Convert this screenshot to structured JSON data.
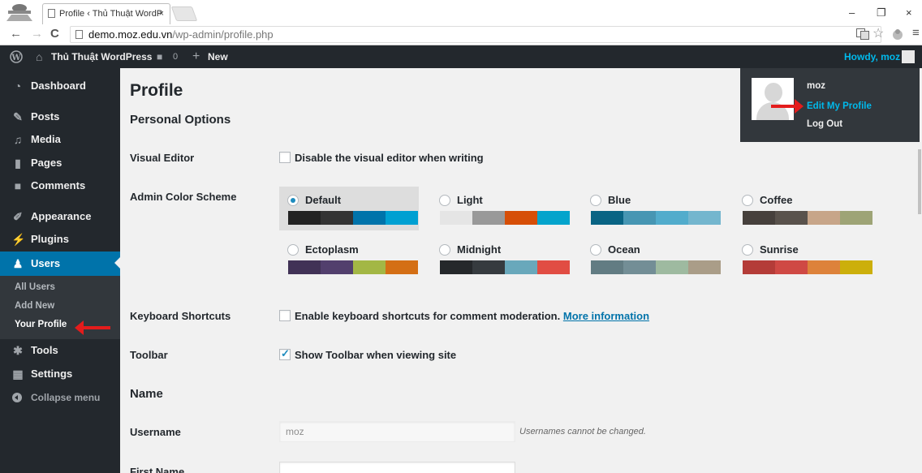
{
  "browser": {
    "tab_title": "Profile ‹ Thủ Thuật WordP",
    "tab_close": "×",
    "url_host": "demo.moz.edu.vn",
    "url_path": "/wp-admin/profile.php",
    "win_min": "–",
    "win_restore": "❐",
    "win_close": "×"
  },
  "adminbar": {
    "site_name": "Thủ Thuật WordPress",
    "comments_count": "0",
    "new_label": "New",
    "howdy": "Howdy, moz"
  },
  "sidebar": {
    "items": [
      {
        "label": "Dashboard",
        "icon": "dashboard-icon"
      },
      {
        "label": "Posts",
        "icon": "pin-icon"
      },
      {
        "label": "Media",
        "icon": "media-icon"
      },
      {
        "label": "Pages",
        "icon": "pages-icon"
      },
      {
        "label": "Comments",
        "icon": "comment-icon"
      },
      {
        "label": "Appearance",
        "icon": "brush-icon"
      },
      {
        "label": "Plugins",
        "icon": "plug-icon"
      },
      {
        "label": "Users",
        "icon": "users-icon"
      },
      {
        "label": "Tools",
        "icon": "wrench-icon"
      },
      {
        "label": "Settings",
        "icon": "settings-icon"
      }
    ],
    "submenu": [
      "All Users",
      "Add New",
      "Your Profile"
    ],
    "collapse": "Collapse menu"
  },
  "page": {
    "title": "Profile",
    "personal_options": "Personal Options",
    "visual_editor_label": "Visual Editor",
    "visual_editor_option": "Disable the visual editor when writing",
    "color_scheme_label": "Admin Color Scheme",
    "keyboard_label": "Keyboard Shortcuts",
    "keyboard_option": "Enable keyboard shortcuts for comment moderation.",
    "keyboard_link": "More information",
    "toolbar_label": "Toolbar",
    "toolbar_option": "Show Toolbar when viewing site",
    "name_heading": "Name",
    "username_label": "Username",
    "username_value": "moz",
    "username_desc": "Usernames cannot be changed.",
    "first_name_label": "First Name",
    "first_name_value": ""
  },
  "color_schemes": [
    {
      "name": "Default",
      "colors": [
        "#222222",
        "#333333",
        "#0073aa",
        "#00a0d2"
      ],
      "selected": true
    },
    {
      "name": "Light",
      "colors": [
        "#e5e5e5",
        "#999999",
        "#d64e07",
        "#04a4cc"
      ],
      "selected": false
    },
    {
      "name": "Blue",
      "colors": [
        "#096484",
        "#4796b3",
        "#52accc",
        "#74b6ce"
      ],
      "selected": false
    },
    {
      "name": "Coffee",
      "colors": [
        "#46403c",
        "#59524c",
        "#c7a589",
        "#9ea476"
      ],
      "selected": false
    },
    {
      "name": "Ectoplasm",
      "colors": [
        "#413256",
        "#523f6d",
        "#a3b745",
        "#d46f15"
      ],
      "selected": false
    },
    {
      "name": "Midnight",
      "colors": [
        "#25282b",
        "#363b3f",
        "#69a8bb",
        "#e14d43"
      ],
      "selected": false
    },
    {
      "name": "Ocean",
      "colors": [
        "#627c83",
        "#738e96",
        "#9ebaa0",
        "#aa9d88"
      ],
      "selected": false
    },
    {
      "name": "Sunrise",
      "colors": [
        "#b43c38",
        "#cf4944",
        "#dd823b",
        "#ccaf0b"
      ],
      "selected": false
    }
  ],
  "dropdown": {
    "name": "moz",
    "edit_profile": "Edit My Profile",
    "logout": "Log Out"
  },
  "colors": {
    "accent": "#0073aa",
    "link_highlight": "#00b9eb",
    "annotation_red": "#e41c1c"
  }
}
